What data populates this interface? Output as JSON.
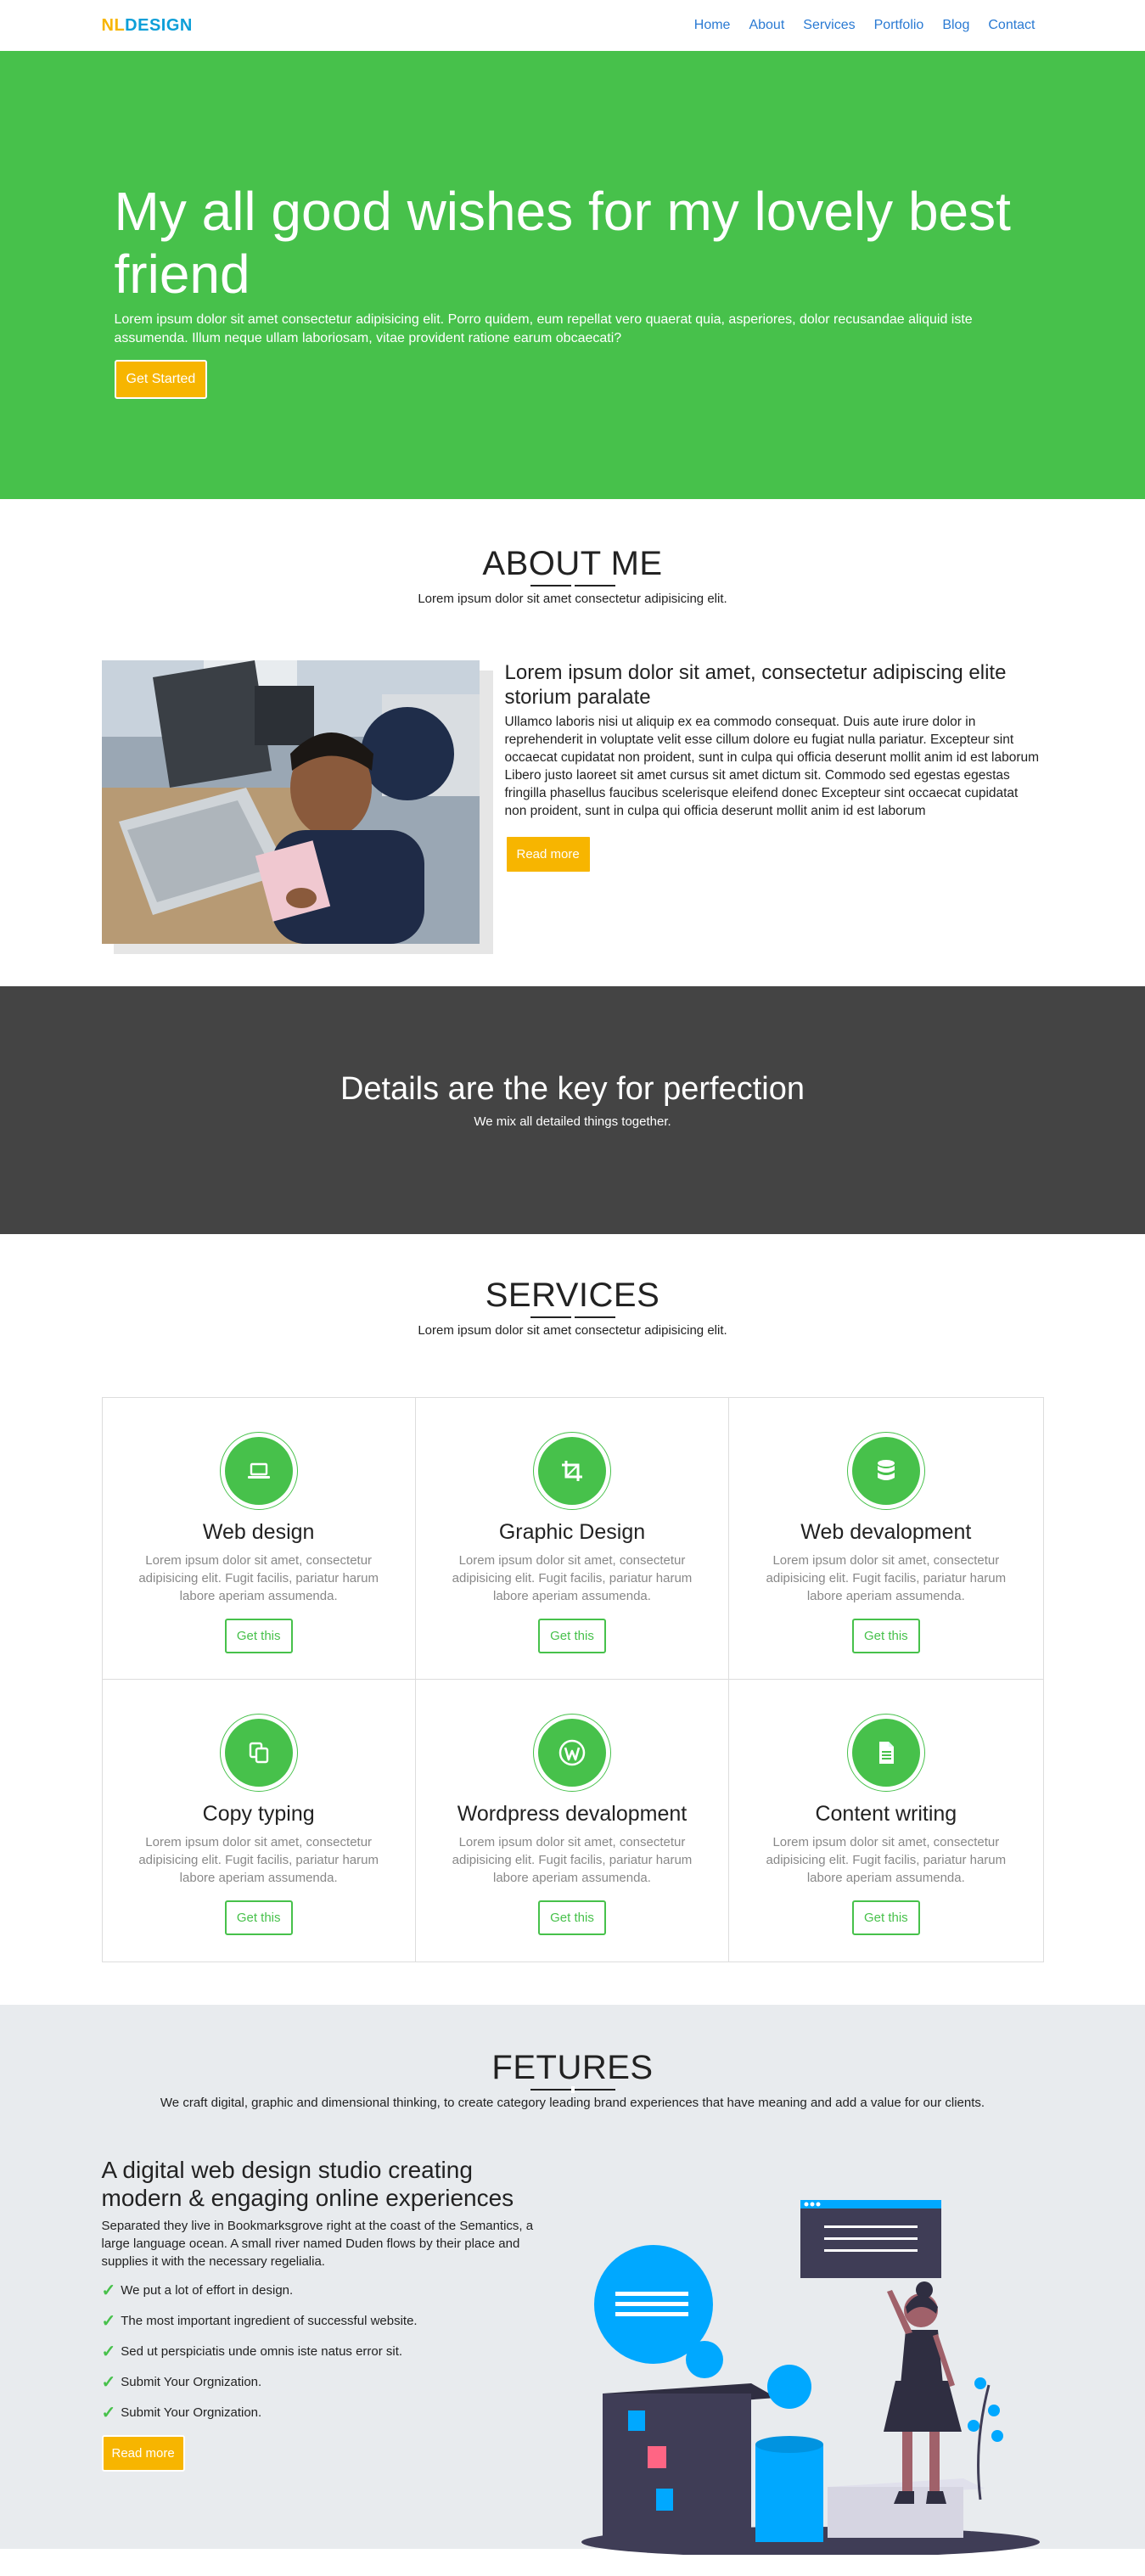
{
  "brand": {
    "part1": "NL",
    "part2": "DESIGN"
  },
  "nav": {
    "items": [
      "Home",
      "About",
      "Services",
      "Portfolio",
      "Blog",
      "Contact"
    ]
  },
  "hero": {
    "title": "My all good wishes for my lovely best friend",
    "text": "Lorem ipsum dolor sit amet consectetur adipisicing elit. Porro quidem, eum repellat vero quaerat quia, asperiores, dolor recusandae aliquid iste assumenda. Illum neque ullam laboriosam, vitae provident ratione earum obcaecati?",
    "button": "Get Started"
  },
  "about": {
    "title": "ABOUT ME",
    "subtitle": "Lorem ipsum dolor sit amet consectetur adipisicing elit.",
    "heading": "Lorem ipsum dolor sit amet, consectetur adipiscing elite storium paralate",
    "body": "Ullamco laboris nisi ut aliquip ex ea commodo consequat. Duis aute irure dolor in reprehenderit in voluptate velit esse cillum dolore eu fugiat nulla pariatur. Excepteur sint occaecat cupidatat non proident, sunt in culpa qui officia deserunt mollit anim id est laborum Libero justo laoreet sit amet cursus sit amet dictum sit. Commodo sed egestas egestas fringilla phasellus faucibus scelerisque eleifend donec Excepteur sint occaecat cupidatat non proident, sunt in culpa qui officia deserunt mollit anim id est laborum",
    "button": "Read more"
  },
  "banner": {
    "title": "Details are the key for perfection",
    "subtitle": "We mix all detailed things together."
  },
  "services": {
    "title": "SERVICES",
    "subtitle": "Lorem ipsum dolor sit amet consectetur adipisicing elit.",
    "items": [
      {
        "icon": "laptop-icon",
        "title": "Web design",
        "text": "Lorem ipsum dolor sit amet, consectetur adipisicing elit. Fugit facilis, pariatur harum labore aperiam assumenda.",
        "button": "Get this"
      },
      {
        "icon": "crop-icon",
        "title": "Graphic Design",
        "text": "Lorem ipsum dolor sit amet, consectetur adipisicing elit. Fugit facilis, pariatur harum labore aperiam assumenda.",
        "button": "Get this"
      },
      {
        "icon": "database-icon",
        "title": "Web devalopment",
        "text": "Lorem ipsum dolor sit amet, consectetur adipisicing elit. Fugit facilis, pariatur harum labore aperiam assumenda.",
        "button": "Get this"
      },
      {
        "icon": "copy-icon",
        "title": "Copy typing",
        "text": "Lorem ipsum dolor sit amet, consectetur adipisicing elit. Fugit facilis, pariatur harum labore aperiam assumenda.",
        "button": "Get this"
      },
      {
        "icon": "wordpress-icon",
        "title": "Wordpress devalopment",
        "text": "Lorem ipsum dolor sit amet, consectetur adipisicing elit. Fugit facilis, pariatur harum labore aperiam assumenda.",
        "button": "Get this"
      },
      {
        "icon": "file-icon",
        "title": "Content writing",
        "text": "Lorem ipsum dolor sit amet, consectetur adipisicing elit. Fugit facilis, pariatur harum labore aperiam assumenda.",
        "button": "Get this"
      }
    ]
  },
  "features": {
    "title": "FETURES",
    "subtitle": "We craft digital, graphic and dimensional thinking, to create category leading brand experiences that have meaning and add a value for our clients.",
    "heading": "A digital web design studio creating modern & engaging online experiences",
    "lead": "Separated they live in Bookmarksgrove right at the coast of the Semantics, a large language ocean. A small river named Duden flows by their place and supplies it with the necessary regelialia.",
    "checks": [
      "We put a lot of effort in design.",
      "The most important ingredient of successful website.",
      "Sed ut perspiciatis unde omnis iste natus error sit.",
      "Submit Your Orgnization.",
      "Submit Your Orgnization."
    ],
    "button": "Read more"
  },
  "colors": {
    "green": "#47c14b",
    "yellow": "#f7b500",
    "blue": "#0d9fd8",
    "dark": "#444444",
    "light": "#e8ebee"
  }
}
